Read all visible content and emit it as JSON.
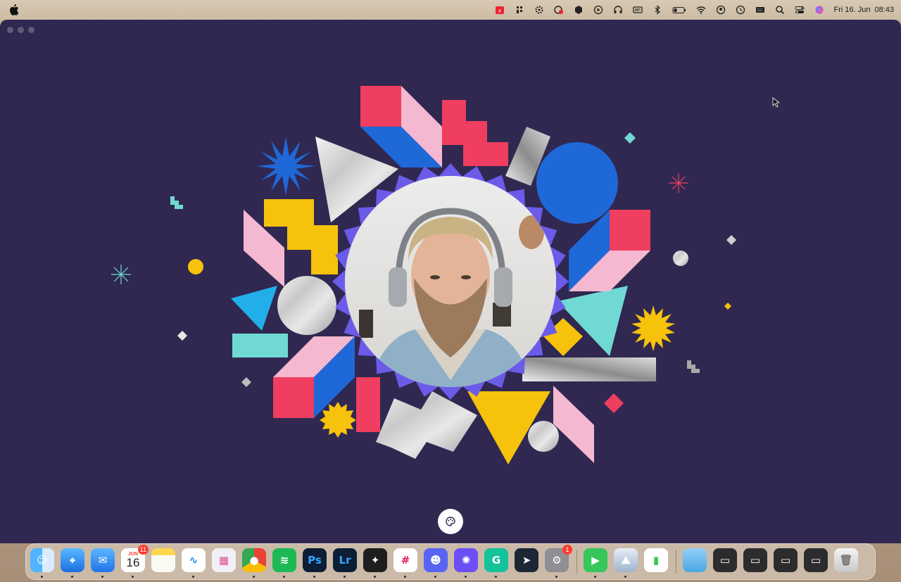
{
  "menubar": {
    "clock": {
      "day": "Fri 16. Jun",
      "time": "08:43"
    },
    "tray_icons": [
      "calendar-badge-icon",
      "grid-icon",
      "gear-icon",
      "screen-record-icon",
      "vpn-icon",
      "play-icon",
      "headphones-icon",
      "display-icon",
      "bluetooth-icon",
      "battery-icon",
      "wifi-icon",
      "user-icon",
      "clock-icon",
      "keyboard-icon",
      "search-icon",
      "control-center-icon",
      "siri-icon"
    ]
  },
  "window": {
    "background": "#302851",
    "theme_button_icon": "palette-icon"
  },
  "colors": {
    "red": "#ef3e5f",
    "pink": "#f4b8d0",
    "blue": "#1f68d8",
    "yellow": "#f6c20c",
    "teal": "#71d9d3",
    "violet": "#6b5be8",
    "sky": "#22aee9"
  },
  "dock": {
    "apps": [
      {
        "name": "Finder",
        "icon": "finder-icon"
      },
      {
        "name": "Safari",
        "icon": "compass-icon"
      },
      {
        "name": "Mail",
        "icon": "mail-icon"
      },
      {
        "name": "Calendar",
        "icon": "calendar-icon",
        "month": "JUN",
        "day": "16",
        "badge": "11"
      },
      {
        "name": "Notes",
        "icon": "notes-icon"
      },
      {
        "name": "Freeform",
        "icon": "freeform-icon"
      },
      {
        "name": "Launchpad",
        "icon": "launchpad-icon"
      },
      {
        "name": "Chrome",
        "icon": "chrome-icon"
      },
      {
        "name": "Spotify",
        "icon": "spotify-icon"
      },
      {
        "name": "Photoshop",
        "icon": "photoshop-icon",
        "label": "Ps"
      },
      {
        "name": "Lightroom",
        "icon": "lightroom-icon",
        "label": "Lr"
      },
      {
        "name": "Figma",
        "icon": "figma-icon"
      },
      {
        "name": "Slack",
        "icon": "slack-icon"
      },
      {
        "name": "Discord",
        "icon": "discord-icon"
      },
      {
        "name": "Perplexity",
        "icon": "asterisk-icon"
      },
      {
        "name": "Grammarly",
        "icon": "grammarly-icon"
      },
      {
        "name": "Cursor",
        "icon": "cursor-app-icon"
      },
      {
        "name": "System Settings",
        "icon": "settings-icon",
        "badge": "1"
      },
      {
        "name": "FaceTime",
        "icon": "facetime-icon"
      },
      {
        "name": "Preview",
        "icon": "preview-icon"
      },
      {
        "name": "Numbers",
        "icon": "numbers-icon"
      },
      {
        "name": "Downloads",
        "icon": "folder-icon"
      },
      {
        "name": "Window 1",
        "icon": "window-thumb-icon"
      },
      {
        "name": "Window 2",
        "icon": "window-thumb-icon"
      },
      {
        "name": "Window 3",
        "icon": "window-thumb-icon"
      },
      {
        "name": "Window 4",
        "icon": "window-thumb-icon"
      },
      {
        "name": "Trash",
        "icon": "trash-icon"
      }
    ]
  }
}
